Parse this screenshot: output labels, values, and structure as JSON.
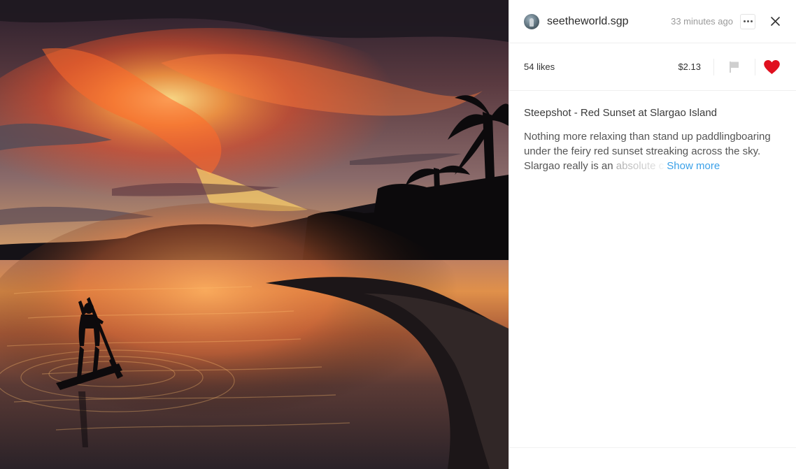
{
  "post": {
    "username": "seetheworld.sgp",
    "timestamp": "33 minutes ago",
    "likes": "54 likes",
    "payout": "$2.13",
    "liked": true,
    "title": "Steepshot - Red Sunset at Slargao Island",
    "body_visible": "Nothing more relaxing than stand up paddlingboaring under the feiry red sunset streaking across the sky. Slargao really is an ",
    "body_faded": "absolute c",
    "show_more_label": "Show more"
  },
  "icons": {
    "avatar": "avatar-icon",
    "more": "more-dots-icon",
    "close": "close-icon",
    "flag": "flag-icon",
    "like": "heart-icon"
  },
  "colors": {
    "heart": "#e0101f",
    "link": "#3aa0e8",
    "flag": "#cfcfcf"
  }
}
